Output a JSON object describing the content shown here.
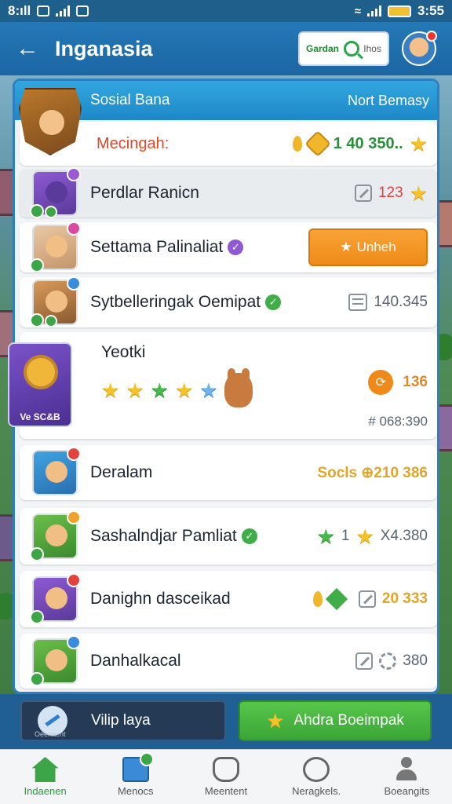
{
  "status_bar": {
    "left_text": "8:ıll",
    "time": "3:55"
  },
  "app_bar": {
    "title": "Inganasia",
    "search_label": "Gardan",
    "search_value": "Ihos"
  },
  "panel": {
    "title": "Sosial Bana",
    "right_label": "Nort Bemasy"
  },
  "rows": [
    {
      "name": "Mecingah:",
      "value": "1 40 350.."
    },
    {
      "name": "Perdlar Ranicn",
      "value": "123"
    },
    {
      "name": "Settama Palinaliat",
      "button_label": "Unheh"
    },
    {
      "name": "Sytbelleringak Oemipat",
      "value": "140.345"
    },
    {
      "name": "Yeotki",
      "value": "136",
      "sub_value": "# 068:390",
      "tile_label": "Ve SC&B"
    },
    {
      "name": "Deralam",
      "value": "Socls ⊕210 386"
    },
    {
      "name": "Sashalndjar Pamliat",
      "value_a": "1",
      "value_b": "X4.380"
    },
    {
      "name": "Danighn dasceikad",
      "value": "20 333"
    },
    {
      "name": "Danhalkacal",
      "value": "380"
    }
  ],
  "actions": {
    "left": "Vilip laya",
    "left_sub": "Oeenaent",
    "right": "Ahdra Boeimpak"
  },
  "nav": [
    {
      "label": "Indaenen",
      "icon": "home-icon",
      "active": true
    },
    {
      "label": "Menocs",
      "icon": "message-icon"
    },
    {
      "label": "Meentent",
      "icon": "shield-icon"
    },
    {
      "label": "Neragkels.",
      "icon": "chat-icon"
    },
    {
      "label": "Boeangits",
      "icon": "user-icon"
    }
  ],
  "colors": {
    "primary": "#1e88c8",
    "accent_orange": "#ef8a1a",
    "accent_green": "#3ba637",
    "active_nav": "#2a9a3a"
  }
}
